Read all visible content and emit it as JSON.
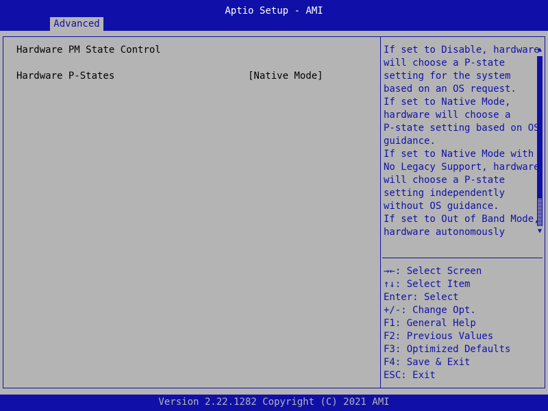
{
  "header": {
    "title": "Aptio Setup - AMI",
    "tab_label": "Advanced"
  },
  "main": {
    "section_title": "Hardware PM State Control",
    "setting": {
      "label": "Hardware P-States",
      "value": "[Native Mode]"
    }
  },
  "help": {
    "lines": [
      "If set to Disable, hardware",
      "will choose a P-state",
      "setting for the system",
      "based on an OS request.",
      "If set to Native Mode,",
      "hardware will choose a",
      "P-state setting based on OS",
      "guidance.",
      "If set to Native Mode with",
      "No Legacy Support, hardware",
      "will choose a P-state",
      "setting independently",
      "without OS guidance.",
      "If set to Out of Band Mode,",
      "hardware autonomously"
    ]
  },
  "scrollbar": {
    "up_arrow": "▲",
    "down_arrow": "▼"
  },
  "keys": {
    "lines": [
      "→←: Select Screen",
      "↑↓: Select Item",
      "Enter: Select",
      "+/-: Change Opt.",
      "F1: General Help",
      "F2: Previous Values",
      "F3: Optimized Defaults",
      "F4: Save & Exit",
      "ESC: Exit"
    ]
  },
  "footer": {
    "text": "Version 2.22.1282 Copyright (C) 2021 AMI"
  },
  "colors": {
    "bios_blue": "#1010a8",
    "background_gray": "#b4b4b4",
    "title_white": "#ffffff"
  }
}
